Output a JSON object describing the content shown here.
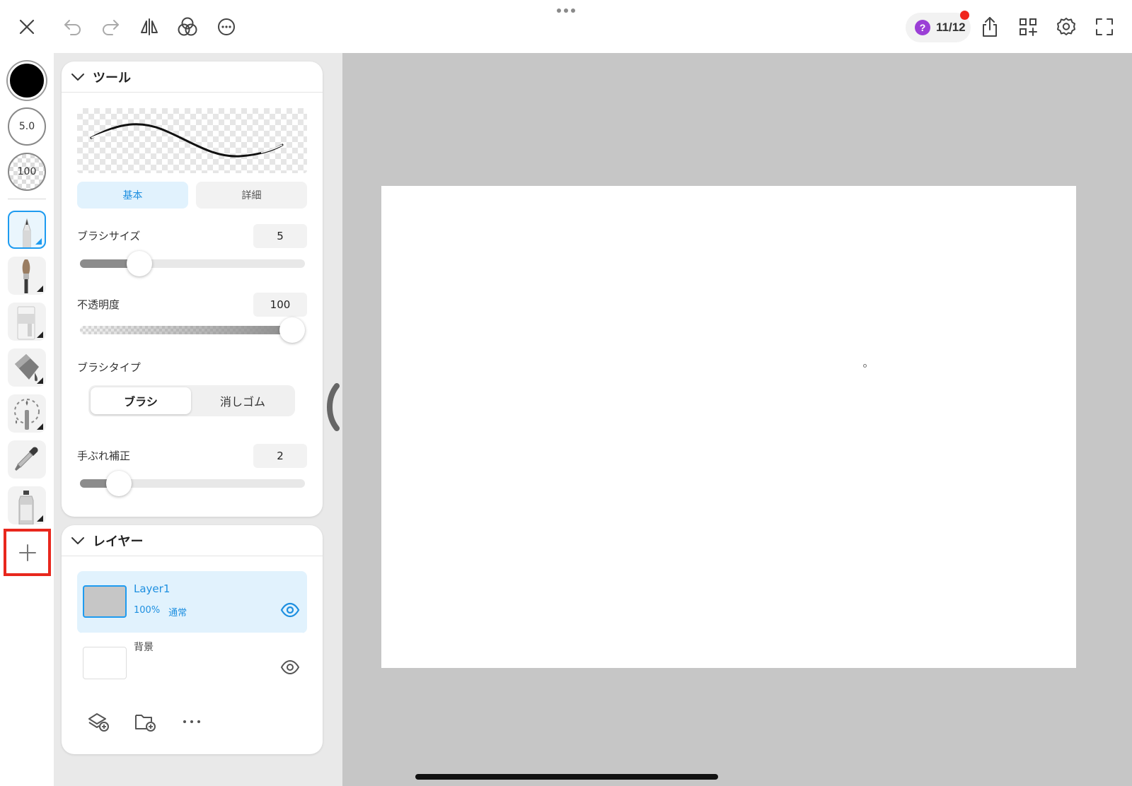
{
  "toolbar": {
    "left_icons": [
      "close-icon",
      "undo-icon",
      "redo-icon",
      "flip-icon",
      "blend-icon",
      "more-icon"
    ],
    "help_count": "11/12",
    "help_mark": "?",
    "right_icons": [
      "share-icon",
      "grid-add-icon",
      "gear-icon",
      "fullscreen-icon"
    ]
  },
  "rail": {
    "brush_color": "#000000",
    "brush_size": "5.0",
    "brush_opacity": "100",
    "tools": [
      "pen-tool-icon",
      "paintbrush-tool-icon",
      "eraser-tool-icon",
      "fill-bucket-tool-icon",
      "selection-tool-icon",
      "eyedropper-tool-icon",
      "spray-tool-icon"
    ],
    "add_tool": "plus-icon"
  },
  "tool_panel": {
    "title": "ツール",
    "tabs": {
      "basic": "基本",
      "detail": "詳細"
    },
    "brush_size_label": "ブラシサイズ",
    "brush_size_value": "5",
    "opacity_label": "不透明度",
    "opacity_value": "100",
    "brush_type_label": "ブラシタイプ",
    "brush_type_options": [
      "ブラシ",
      "消しゴム"
    ],
    "stabilizer_label": "手ぶれ補正",
    "stabilizer_value": "2"
  },
  "layer_panel": {
    "title": "レイヤー",
    "layers": [
      {
        "name": "Layer1",
        "opacity": "100%",
        "blend": "通常"
      },
      {
        "name": "背景"
      }
    ],
    "actions": [
      "add-layer-icon",
      "add-folder-icon",
      "more-icon"
    ]
  },
  "colors": {
    "accent": "#1d9bf0",
    "highlight_box": "#e8271d",
    "notification": "#f0261c",
    "help_badge": "#9b3fd6"
  }
}
